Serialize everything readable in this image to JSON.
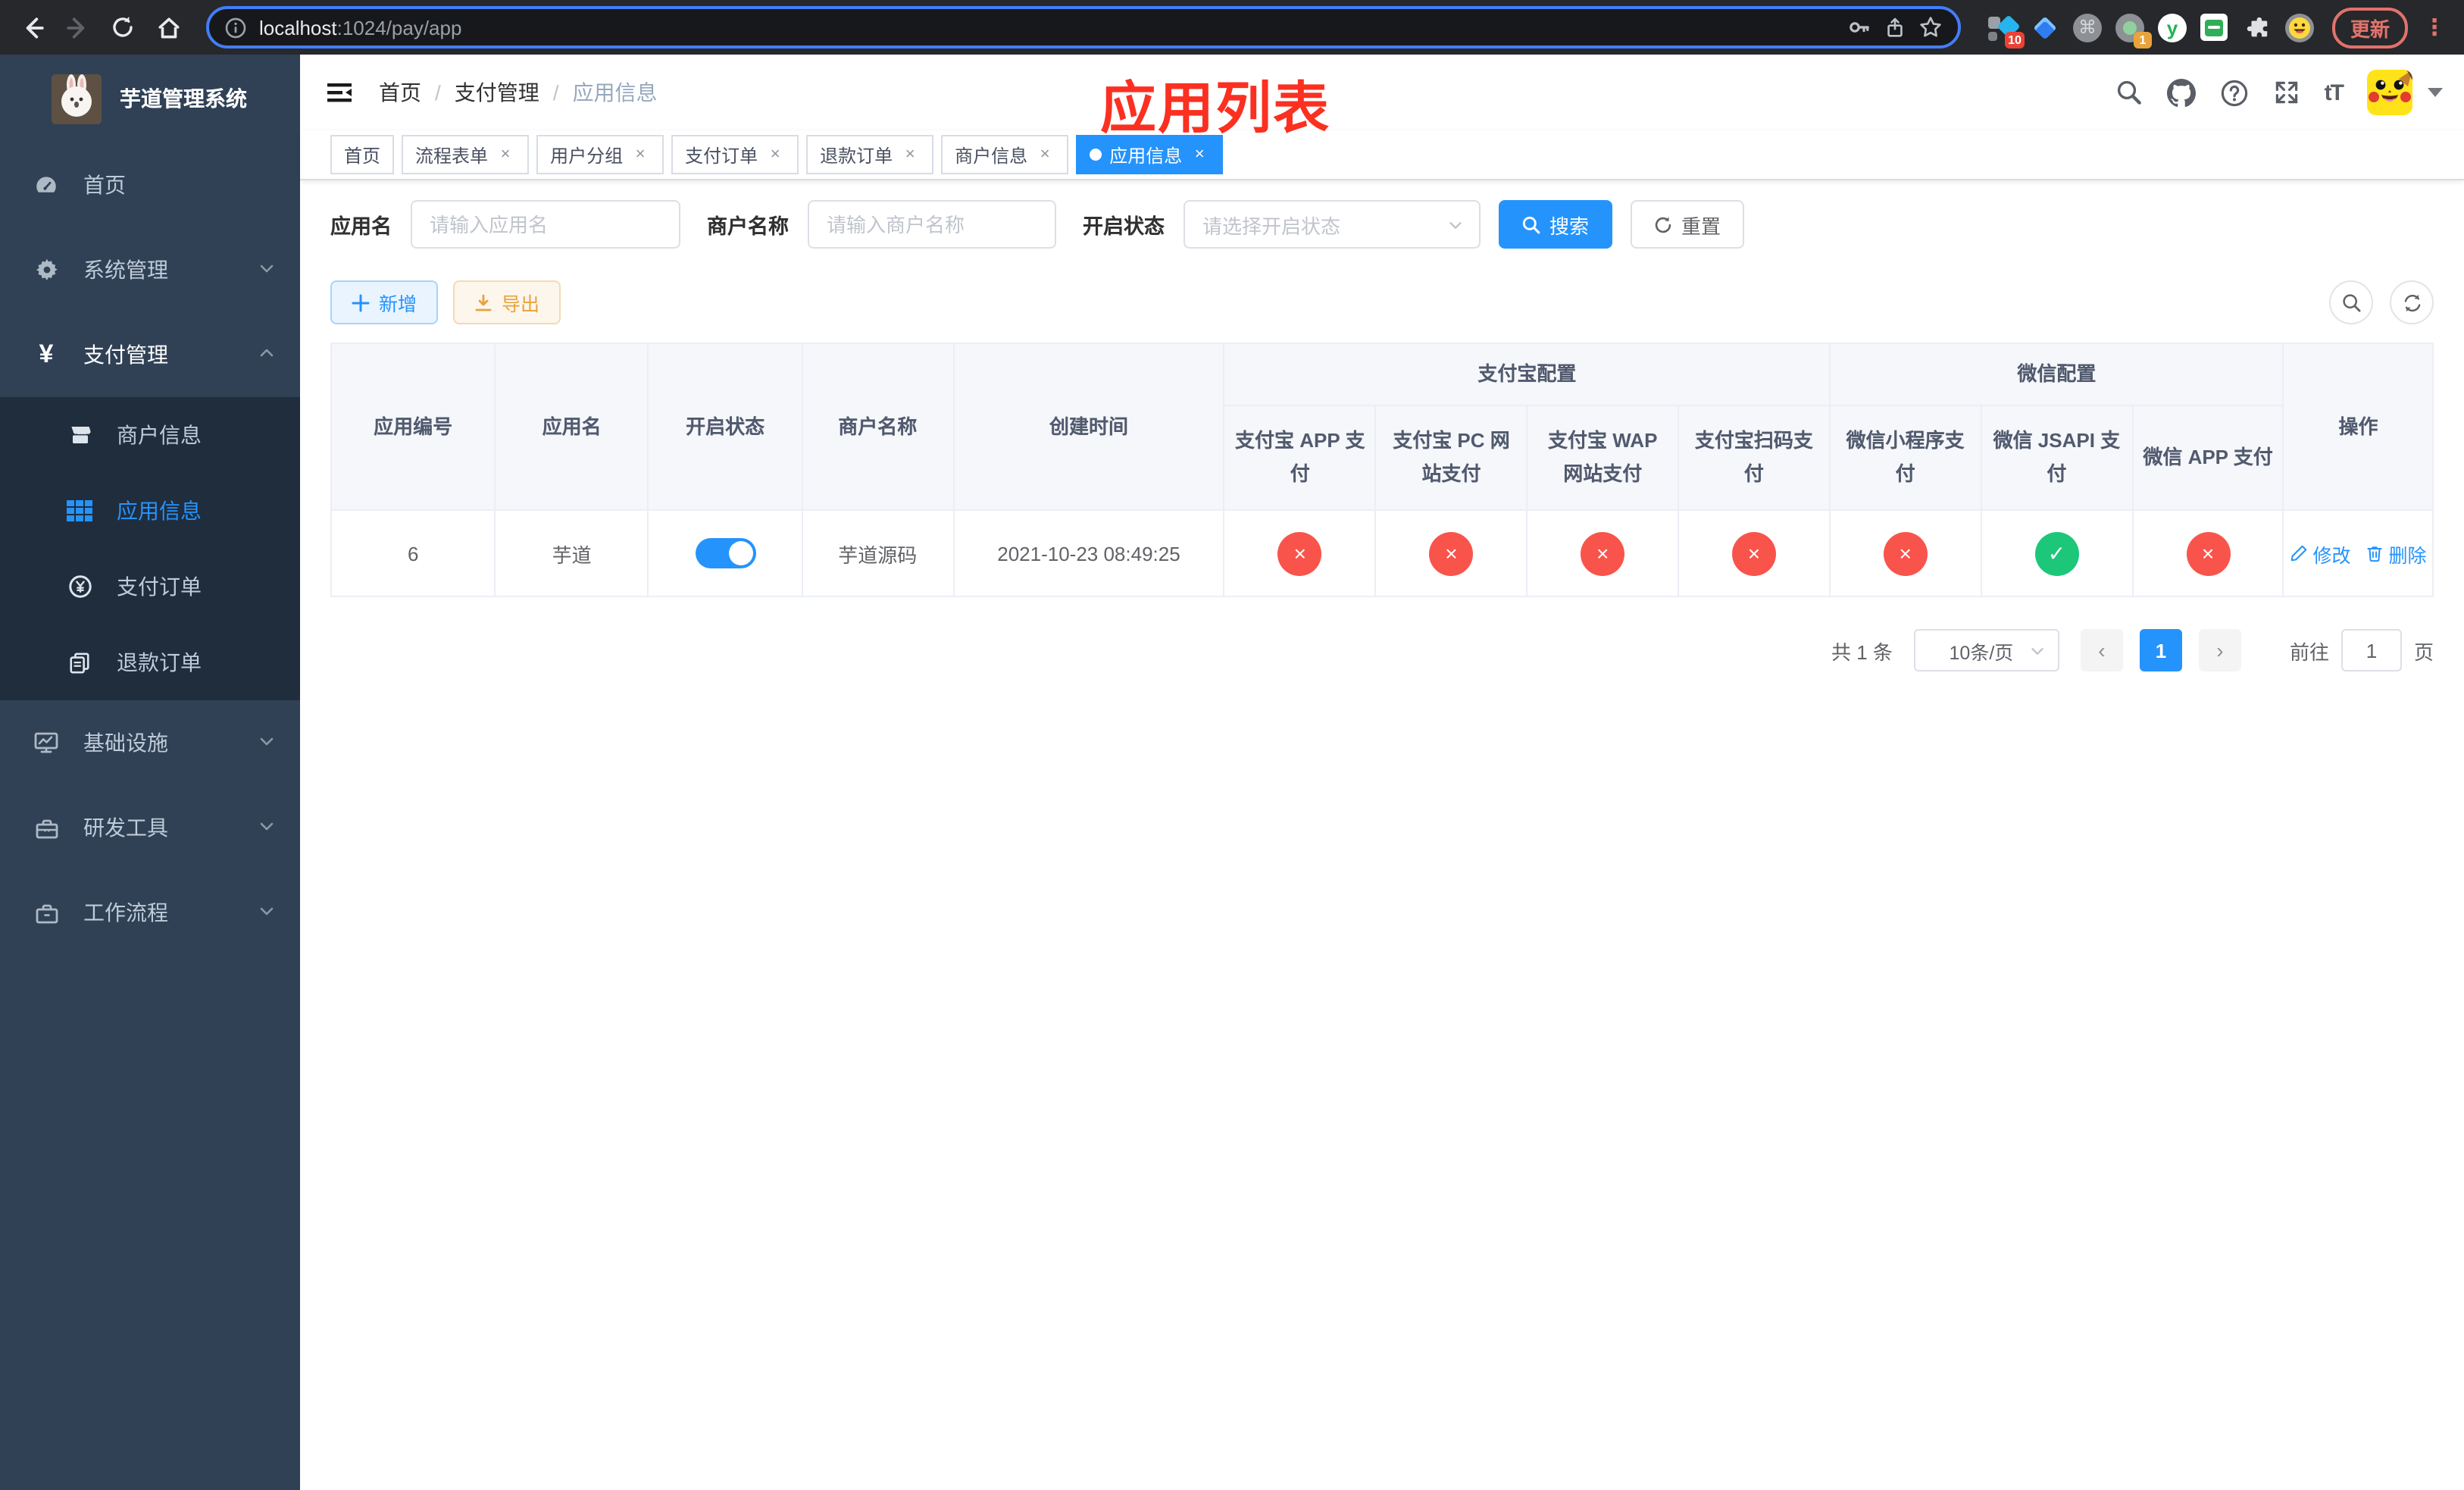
{
  "colors": {
    "accent": "#2593fc",
    "danger": "#f9544b",
    "success": "#1dc779",
    "warning": "#e6a23c",
    "annotation_red": "#fb3021",
    "sidebar_bg": "#304156",
    "submenu_bg": "#1f2d3d",
    "browser_bar_bg": "#26282b"
  },
  "browser": {
    "url_host": "localhost",
    "url_rest": ":1024/pay/app",
    "ext_badge_tampermonkey": "10",
    "ext_badge_session": "1",
    "ext_letter_y": "y",
    "update_label": "更新",
    "kebab": "⋮",
    "cmd_glyph": "⌘"
  },
  "sidebar": {
    "title": "芋道管理系统",
    "items": {
      "home": "首页",
      "system": "系统管理",
      "pay": "支付管理",
      "infra": "基础设施",
      "devtools": "研发工具",
      "workflow": "工作流程"
    },
    "pay_children": [
      "商户信息",
      "应用信息",
      "支付订单",
      "退款订单"
    ]
  },
  "navbar": {
    "breadcrumb": [
      "首页",
      "支付管理",
      "应用信息"
    ],
    "annotation": "应用列表",
    "font_size_icon": "tT"
  },
  "tabs": [
    {
      "label": "首页"
    },
    {
      "label": "流程表单"
    },
    {
      "label": "用户分组"
    },
    {
      "label": "支付订单"
    },
    {
      "label": "退款订单"
    },
    {
      "label": "商户信息"
    },
    {
      "label": "应用信息"
    }
  ],
  "filter": {
    "app_name_label": "应用名",
    "app_name_placeholder": "请输入应用名",
    "merchant_label": "商户名称",
    "merchant_placeholder": "请输入商户名称",
    "status_label": "开启状态",
    "status_placeholder": "请选择开启状态",
    "search_label": "搜索",
    "reset_label": "重置"
  },
  "toolbar": {
    "add_label": "新增",
    "export_label": "导出"
  },
  "table": {
    "columns": [
      "应用编号",
      "应用名",
      "开启状态",
      "商户名称",
      "创建时间"
    ],
    "group_alipay": "支付宝配置",
    "alipay_children": [
      "支付宝 APP 支付",
      "支付宝 PC 网站支付",
      "支付宝 WAP 网站支付",
      "支付宝扫码支付"
    ],
    "group_wechat": "微信配置",
    "wechat_children": [
      "微信小程序支付",
      "微信 JSAPI 支付",
      "微信 APP 支付"
    ],
    "op_column": "操作",
    "row": {
      "id": "6",
      "name": "芋道",
      "merchant": "芋道源码",
      "created_at": "2021-10-23 08:49:25",
      "statuses": [
        "×",
        "×",
        "×",
        "×",
        "×",
        "✓",
        "×"
      ],
      "edit_label": "修改",
      "delete_label": "删除"
    }
  },
  "pagination": {
    "total": "共 1 条",
    "page_size": "10条/页",
    "page": "1",
    "goto_label": "前往",
    "goto_value": "1",
    "goto_suffix": "页"
  }
}
